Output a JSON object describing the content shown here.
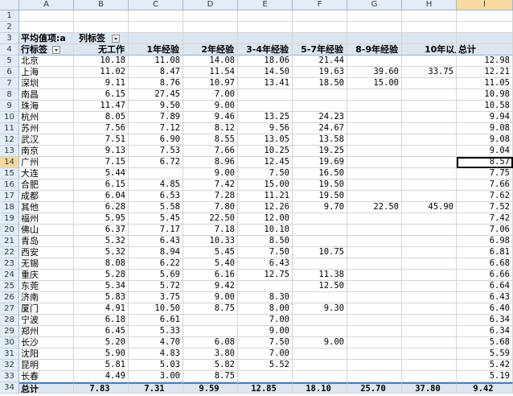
{
  "columns": [
    "A",
    "B",
    "C",
    "D",
    "E",
    "F",
    "G",
    "H",
    "I"
  ],
  "active_col": "I",
  "active_row": 14,
  "pivot": {
    "value_label": "平均值项:a",
    "col_label": "列标签",
    "row_label": "行标签",
    "headers": [
      "无工作",
      "1年经验",
      "2年经验",
      "3-4年经验",
      "5-7年经验",
      "8-9年经验",
      "10年以上",
      "总计"
    ],
    "rows": [
      {
        "city": "北京",
        "v": [
          "10.18",
          "11.08",
          "14.08",
          "18.06",
          "21.44",
          "",
          "",
          "12.98"
        ]
      },
      {
        "city": "上海",
        "v": [
          "11.02",
          "8.47",
          "11.54",
          "14.50",
          "19.63",
          "39.60",
          "33.75",
          "12.21"
        ]
      },
      {
        "city": "深圳",
        "v": [
          "9.11",
          "8.76",
          "10.97",
          "13.41",
          "18.50",
          "15.00",
          "",
          "11.05"
        ]
      },
      {
        "city": "南昌",
        "v": [
          "6.15",
          "27.45",
          "7.00",
          "",
          "",
          "",
          "",
          "10.98"
        ]
      },
      {
        "city": "珠海",
        "v": [
          "11.47",
          "9.50",
          "9.00",
          "",
          "",
          "",
          "",
          "10.58"
        ]
      },
      {
        "city": "杭州",
        "v": [
          "8.05",
          "7.89",
          "9.46",
          "13.25",
          "24.23",
          "",
          "",
          "9.94"
        ]
      },
      {
        "city": "苏州",
        "v": [
          "7.56",
          "7.12",
          "8.12",
          "9.56",
          "24.67",
          "",
          "",
          "9.08"
        ]
      },
      {
        "city": "武汉",
        "v": [
          "7.51",
          "6.90",
          "8.55",
          "13.05",
          "13.58",
          "",
          "",
          "9.08"
        ]
      },
      {
        "city": "南京",
        "v": [
          "9.13",
          "7.53",
          "7.66",
          "10.25",
          "19.25",
          "",
          "",
          "9.04"
        ]
      },
      {
        "city": "广州",
        "v": [
          "7.15",
          "6.72",
          "8.96",
          "12.45",
          "19.69",
          "",
          "",
          "8.57"
        ]
      },
      {
        "city": "大连",
        "v": [
          "5.44",
          "",
          "9.00",
          "7.50",
          "16.50",
          "",
          "",
          "7.75"
        ]
      },
      {
        "city": "合肥",
        "v": [
          "6.15",
          "4.85",
          "7.42",
          "15.00",
          "19.50",
          "",
          "",
          "7.66"
        ]
      },
      {
        "city": "成都",
        "v": [
          "6.04",
          "6.53",
          "7.28",
          "11.21",
          "19.50",
          "",
          "",
          "7.62"
        ]
      },
      {
        "city": "其他",
        "v": [
          "6.28",
          "5.58",
          "7.80",
          "12.26",
          "9.70",
          "22.50",
          "45.90",
          "7.52"
        ]
      },
      {
        "city": "福州",
        "v": [
          "5.95",
          "5.45",
          "22.50",
          "12.00",
          "",
          "",
          "",
          "7.42"
        ]
      },
      {
        "city": "佛山",
        "v": [
          "6.37",
          "7.17",
          "7.18",
          "10.10",
          "",
          "",
          "",
          "7.06"
        ]
      },
      {
        "city": "青岛",
        "v": [
          "5.32",
          "6.43",
          "10.33",
          "8.50",
          "",
          "",
          "",
          "6.98"
        ]
      },
      {
        "city": "西安",
        "v": [
          "5.32",
          "8.94",
          "5.45",
          "7.50",
          "10.75",
          "",
          "",
          "6.81"
        ]
      },
      {
        "city": "无锡",
        "v": [
          "8.08",
          "6.22",
          "5.40",
          "6.43",
          "",
          "",
          "",
          "6.68"
        ]
      },
      {
        "city": "重庆",
        "v": [
          "5.28",
          "5.69",
          "6.16",
          "12.75",
          "11.38",
          "",
          "",
          "6.66"
        ]
      },
      {
        "city": "东莞",
        "v": [
          "5.34",
          "5.72",
          "9.42",
          "",
          "12.50",
          "",
          "",
          "6.64"
        ]
      },
      {
        "city": "济南",
        "v": [
          "5.83",
          "3.75",
          "9.00",
          "8.30",
          "",
          "",
          "",
          "6.43"
        ]
      },
      {
        "city": "厦门",
        "v": [
          "4.91",
          "10.50",
          "8.75",
          "8.00",
          "9.30",
          "",
          "",
          "6.40"
        ]
      },
      {
        "city": "宁波",
        "v": [
          "6.18",
          "6.61",
          "",
          "7.00",
          "",
          "",
          "",
          "6.34"
        ]
      },
      {
        "city": "郑州",
        "v": [
          "6.45",
          "5.33",
          "",
          "9.00",
          "",
          "",
          "",
          "6.34"
        ]
      },
      {
        "city": "长沙",
        "v": [
          "5.20",
          "4.70",
          "6.08",
          "7.50",
          "9.00",
          "",
          "",
          "5.68"
        ]
      },
      {
        "city": "沈阳",
        "v": [
          "5.90",
          "4.83",
          "3.80",
          "7.00",
          "",
          "",
          "",
          "5.59"
        ]
      },
      {
        "city": "昆明",
        "v": [
          "5.81",
          "5.03",
          "5.82",
          "5.52",
          "",
          "",
          "",
          "5.42"
        ]
      },
      {
        "city": "长春",
        "v": [
          "4.49",
          "3.00",
          "8.75",
          "",
          "",
          "",
          "",
          "5.19"
        ]
      }
    ],
    "total": {
      "label": "总计",
      "v": [
        "7.83",
        "7.31",
        "9.59",
        "12.85",
        "18.10",
        "25.70",
        "37.80",
        "9.42"
      ]
    }
  },
  "colors": {
    "header_band": "#dce6f1",
    "selection": "#000000",
    "active_header": "#f9d99f"
  }
}
